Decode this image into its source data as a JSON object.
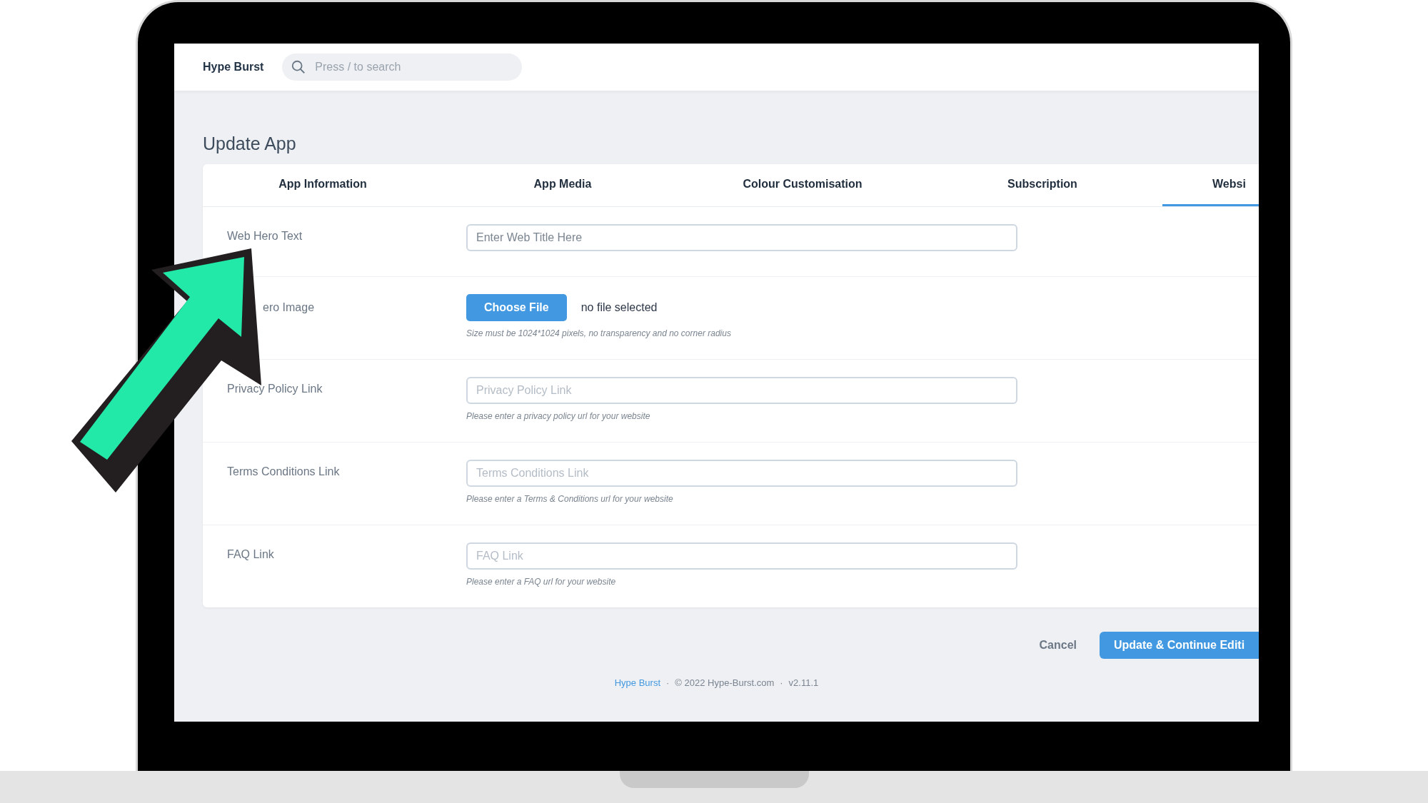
{
  "header": {
    "brand": "Hype Burst",
    "search": {
      "placeholder": "Press / to search"
    }
  },
  "page_title": "Update App",
  "tabs": [
    {
      "label": "App Information",
      "selected": false
    },
    {
      "label": "App Media",
      "selected": false
    },
    {
      "label": "Colour Customisation",
      "selected": false
    },
    {
      "label": "Subscription",
      "selected": false
    },
    {
      "label": "Websi",
      "selected": true
    }
  ],
  "fields": [
    {
      "kind": "text",
      "label": "Web Hero Text",
      "placeholder": "Enter Web Title Here"
    },
    {
      "kind": "file",
      "label": "ero Image",
      "button": "Choose File",
      "status": "no file selected",
      "help": "Size must be 1024*1024 pixels, no transparency and no corner radius"
    },
    {
      "kind": "text",
      "label": "Privacy Policy Link",
      "placeholder": "Privacy Policy Link",
      "help": "Please enter a privacy policy url for your website"
    },
    {
      "kind": "text",
      "label": "Terms Conditions Link",
      "placeholder": "Terms Conditions Link",
      "help": "Please enter a Terms & Conditions url for your website"
    },
    {
      "kind": "text",
      "label": "FAQ Link",
      "placeholder": "FAQ Link",
      "help": "Please enter a FAQ url for your website"
    }
  ],
  "actions": {
    "cancel": "Cancel",
    "submit": "Update & Continue Editi"
  },
  "footer": {
    "link": "Hype Burst",
    "separator": "·",
    "copyright": "© 2022 Hype-Burst.com",
    "version": "v2.11.1"
  }
}
